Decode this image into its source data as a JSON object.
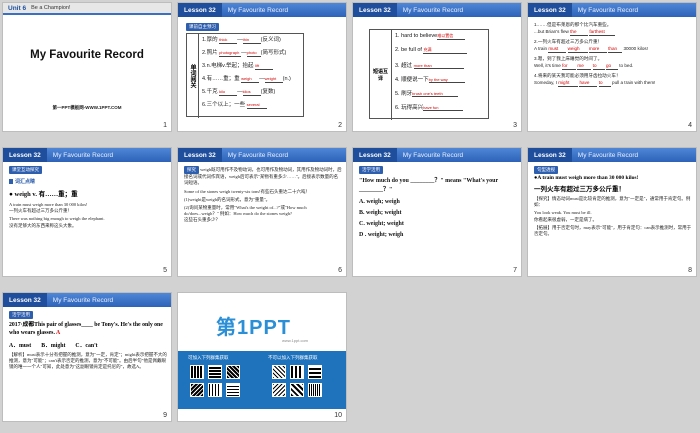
{
  "slides": [
    {
      "num": "1",
      "unit": "Unit 6",
      "unit_title": "Be a Champion!",
      "title": "My Favourite Record",
      "footer": "第一PPT模板网-WWW.1PPT.COM"
    },
    {
      "num": "2",
      "lesson": "Lesson 32",
      "header": "My Favourite Record",
      "tag": "课前自主预习",
      "side": "单词阅关",
      "items": [
        {
          "n": "1.",
          "cn": "厚的",
          "a": "thick",
          "b": "thin",
          "note": "(反义词)"
        },
        {
          "n": "2.",
          "cn": "照片",
          "a": "photograph",
          "b": "photo",
          "note": "(简写形式)"
        },
        {
          "n": "3.",
          "cn": "n.电梯v.举起；抬起",
          "a": "lift"
        },
        {
          "n": "4.",
          "cn": "有……重；重",
          "a": "weigh",
          "b": "weight",
          "note": "(n.)"
        },
        {
          "n": "5.",
          "cn": "千克",
          "a": "kilo",
          "b": "kilos",
          "note": "(复数)"
        },
        {
          "n": "6.",
          "cn": "三个以上；一些",
          "a": "several"
        }
      ]
    },
    {
      "num": "3",
      "lesson": "Lesson 32",
      "header": "My Favourite Record",
      "side": "短语互译",
      "items": [
        {
          "n": "1.",
          "en": "hard to believe",
          "ans": "难以置信"
        },
        {
          "n": "2.",
          "en": "be full of",
          "ans": "充满"
        },
        {
          "n": "3.",
          "cn": "超过",
          "ans": "more than"
        },
        {
          "n": "4.",
          "cn": "顺便说一下",
          "ans": "by the way"
        },
        {
          "n": "5.",
          "cn": "刷牙",
          "ans": "brush one's teeth"
        },
        {
          "n": "6.",
          "cn": "玩得高兴",
          "ans": "have fun"
        }
      ]
    },
    {
      "num": "4",
      "lesson": "Lesson 32",
      "header": "My Favourite Record",
      "lines": [
        {
          "n": "1.",
          "cn": "……但是布莱恩的那个比汽车重些。",
          "en": "...but Brian's flew",
          "ans1": "the",
          "mid": "",
          "ans2": "farthest"
        },
        {
          "n": "2.",
          "cn": "一列火车有超过三万多公斤重！",
          "en": "A train",
          "ans1": "must",
          "mid": "weigh",
          "ans2": "more",
          "extra": "than",
          "tail": "30000 kilos!"
        },
        {
          "n": "3.",
          "cn": "嗯，到了我上床睡觉的时间了。",
          "en": "Well, it's time",
          "ans1": "for",
          "mid": "me",
          "ans2": "to",
          "extra": "go",
          "tail": "to bed."
        },
        {
          "n": "4.",
          "cn": "将来的某天我可能必须用牙齿拉动火车！",
          "en": "Someday, I",
          "ans1": "might",
          "mid": "have",
          "ans2": "to",
          "tail": "pull a train with them!"
        }
      ]
    },
    {
      "num": "5",
      "lesson": "Lesson 32",
      "header": "My Favourite Record",
      "tag": "课堂互动探究",
      "sub": "词汇点睛",
      "point": "● weigh v. 有……重；重",
      "ex1": "A train must weigh more than 30 000 kilos!",
      "ex1cn": "一列火车有超过三万多公斤重！",
      "ex2": "There was nothing big enough to weigh the elephant.",
      "ex2cn": "没有足够大的东西来称这头大象。"
    },
    {
      "num": "6",
      "lesson": "Lesson 32",
      "header": "My Favourite Record",
      "tag": "探究",
      "body": [
        "weigh既可用作不及物动词，也可用作及物动词，其用作及物动词时，后接名词或代词作宾语，weigh后可表示\"某物有重多少……\"。后接表示数量的名词短语。",
        "Some of the stones weigh twenty-six tons!有些石头重达二十六吨！",
        "(1)weight是weigh的名词形式，意为\"重量\"。",
        "(2)询问某物重量时，常用\"What's the weight of...?\"或\"How much do/does...weigh？\"  例如：How much do the stones weigh?",
        "这些石头重多少？"
      ]
    },
    {
      "num": "7",
      "lesson": "Lesson 32",
      "header": "My Favourite Record",
      "tag": "活学活用",
      "q": "\"How much do you ________？\" means \"What's your ________？\"",
      "options": [
        "A. weigh; weigh",
        "B. weigh; weight",
        "C. weight; weight",
        "D . weight; weigh"
      ]
    },
    {
      "num": "8",
      "lesson": "Lesson 32",
      "header": "My Favourite Record",
      "tag": "句型透视",
      "point": "●A train must weigh more than 30 000 kilos!",
      "pointcn": "一列火车有超过三万多公斤重！",
      "body1": "【探究】情态动词must是比较肯定的推测，意为\"一定是\"，通常用于肯定句。例如：",
      "ex": "You look weak. You must be ill.",
      "excn": "你看起来很虚弱，一定是病了。",
      "body2": "【拓展】用于否定句时，may表示\"可能\"，用于肯定句：can表示推测时，常用于否定句。"
    },
    {
      "num": "9",
      "lesson": "Lesson 32",
      "header": "My Favourite Record",
      "tag": "活学活用",
      "q": "2017·成都This pair of glasses____ be Tony's. He's the only one who wears glasses.",
      "ans": "A",
      "options": [
        "A．must",
        "B．might",
        "C．can't"
      ],
      "expl": "【解析】must表示十分有把握的推测，意为\"一定，肯定\"；might表示把握不大的推测，意为\"可能\"；can't表示否定的推测，意为\"不可能\"。由后半句\"他是佩戴眼镜的唯一一个人\"可知，此处意为\"这副眼镜肯定是托尼的\"，故选A。"
    },
    {
      "num": "10",
      "logo": "第1PPT",
      "logo_sub": "www.1ppt.com",
      "qr1": "可加入下列群集获取",
      "qr2": "不可以加入下列群集获取"
    }
  ]
}
